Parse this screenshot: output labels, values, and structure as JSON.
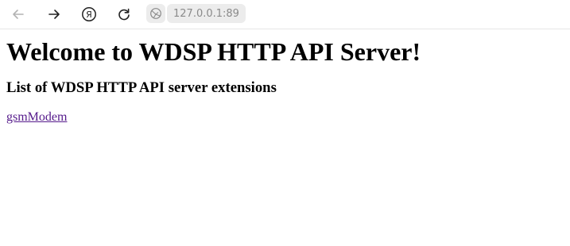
{
  "browser": {
    "address": "127.0.0.1:89",
    "icons": [
      "back-arrow-icon",
      "forward-arrow-icon",
      "yandex-logo-icon",
      "reload-icon",
      "globe-icon"
    ],
    "colors": {
      "link_visited": "#551a8b",
      "address_pill": "#ececec",
      "address_text": "#8a8a8a"
    }
  },
  "page": {
    "heading": "Welcome to WDSP HTTP API Server!",
    "subheading": "List of WDSP HTTP API server extensions",
    "extensions": [
      "gsmModem"
    ]
  }
}
